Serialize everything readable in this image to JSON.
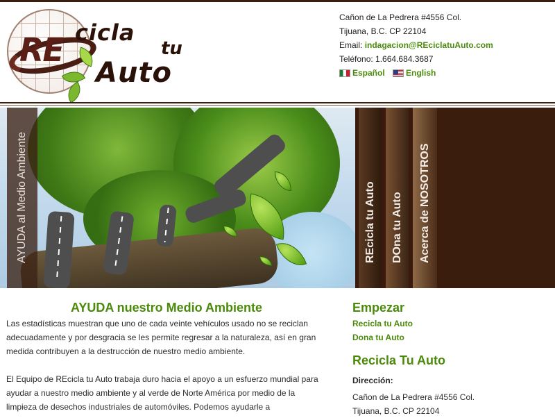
{
  "header": {
    "logo": {
      "part1": "RE",
      "part2": "cicla",
      "part3": "tu",
      "part4": "Auto"
    },
    "contact": {
      "address_line1": "Cañon de La Pedrera #4556 Col.",
      "address_line2": "Tijuana, B.C. CP 22104",
      "email_label": "Email:",
      "email": "indagacion@REciclatuAuto.com",
      "phone": "Teléfono: 1.664.684.3687"
    },
    "languages": [
      {
        "label": "Español",
        "icon": "mexico-flag-icon"
      },
      {
        "label": "English",
        "icon": "usa-flag-icon"
      }
    ]
  },
  "banner": {
    "main_tab": "AYUDA al Medio Ambiente",
    "tabs": [
      {
        "label": "REcicla tu Auto"
      },
      {
        "label": "DOna tu Auto"
      },
      {
        "label": "Acerca de NOSOTROS"
      }
    ]
  },
  "main": {
    "title": "AYUDA nuestro Medio Ambiente",
    "paragraph1": "Las estadísticas muestran que uno de cada veinte vehículos usado no se reciclan adecuadamente y por desgracia se les permite regresar a la naturaleza, así en gran medida contribuyen a la destrucción de nuestro medio ambiente.",
    "paragraph2": "El Equipo de REcicla tu Auto trabaja duro hacia el apoyo a un esfuerzo mundial para ayudar a nuestro medio ambiente y al verde de Norte América por medio de la limpieza de desechos industriales de automóviles. Podemos ayudarle a"
  },
  "sidebar": {
    "start_title": "Empezar",
    "links": [
      {
        "label": "Recicla tu Auto"
      },
      {
        "label": "Dona tu Auto"
      }
    ],
    "section_title": "Recicla Tu Auto",
    "address_label": "Dirección:",
    "address_line1": "Cañon de La Pedrera #4556 Col.",
    "address_line2": "Tijuana, B.C. CP 22104"
  },
  "colors": {
    "accent_green": "#4c8a0b",
    "brand_brown": "#3b1e10"
  }
}
